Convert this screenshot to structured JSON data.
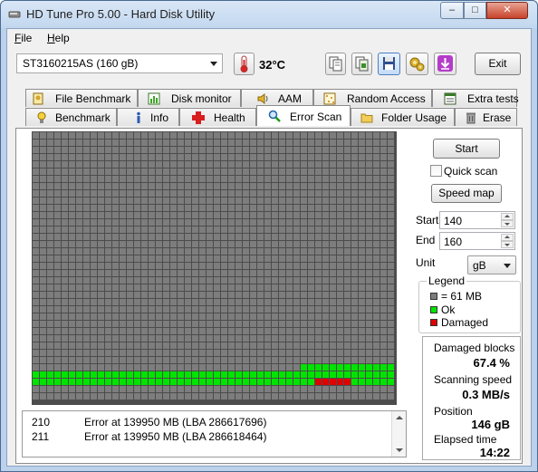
{
  "window": {
    "title": "HD Tune Pro 5.00 - Hard Disk Utility",
    "controls": {
      "minimize": "–",
      "maximize": "□",
      "close": "✕"
    }
  },
  "menu": {
    "file": "File",
    "help": "Help"
  },
  "toolbar": {
    "drive": "ST3160215AS (160 gB)",
    "temperature": "32°C",
    "icons": [
      "thermometer-icon",
      "copy-text-icon",
      "copy-screenshot-icon",
      "save-icon",
      "options-icon",
      "download-icon"
    ],
    "exit_label": "Exit"
  },
  "tabs": {
    "row1": [
      {
        "label": "File Benchmark",
        "icon": "file-benchmark-icon"
      },
      {
        "label": "Disk monitor",
        "icon": "disk-monitor-icon"
      },
      {
        "label": "AAM",
        "icon": "speaker-icon"
      },
      {
        "label": "Random Access",
        "icon": "random-access-icon"
      },
      {
        "label": "Extra tests",
        "icon": "extra-tests-icon"
      }
    ],
    "row2": [
      {
        "label": "Benchmark",
        "icon": "bulb-icon"
      },
      {
        "label": "Info",
        "icon": "info-icon"
      },
      {
        "label": "Health",
        "icon": "health-cross-icon"
      },
      {
        "label": "Error Scan",
        "icon": "magnifier-icon"
      },
      {
        "label": "Folder Usage",
        "icon": "folder-icon"
      },
      {
        "label": "Erase",
        "icon": "trash-icon"
      }
    ],
    "active": "Error Scan"
  },
  "scan_map": {
    "columns": 50,
    "rows": 37,
    "block_colors": {
      "unscanned": "#7d7d7d",
      "ok": "#00e400",
      "damaged": "#e00000"
    },
    "ok_row_start": {
      "row": 32,
      "col": 37
    },
    "ok_rows_full": [
      33,
      34
    ],
    "damaged_row": {
      "row": 34,
      "from": 39,
      "to": 43
    }
  },
  "log": [
    {
      "num": "210",
      "message": "Error at 139950 MB (LBA 286617696)"
    },
    {
      "num": "211",
      "message": "Error at 139950 MB (LBA 286618464)"
    }
  ],
  "controls": {
    "start_button": "Start",
    "quick_scan_label": "Quick scan",
    "quick_scan_checked": false,
    "speed_map_button": "Speed map",
    "start_label": "Start",
    "start_value": "140",
    "end_label": "End",
    "end_value": "160",
    "unit_label": "Unit",
    "unit_value": "gB"
  },
  "legend": {
    "title": "Legend",
    "items": [
      {
        "label": "= 61 MB",
        "color": "#7d7d7d"
      },
      {
        "label": "Ok",
        "color": "#00e400"
      },
      {
        "label": "Damaged",
        "color": "#e00000"
      }
    ]
  },
  "stats": {
    "damaged_label": "Damaged blocks",
    "damaged_value": "67.4 %",
    "speed_label": "Scanning speed",
    "speed_value": "0.3 MB/s",
    "position_label": "Position",
    "position_value": "146 gB",
    "elapsed_label": "Elapsed time",
    "elapsed_value": "14:22"
  }
}
